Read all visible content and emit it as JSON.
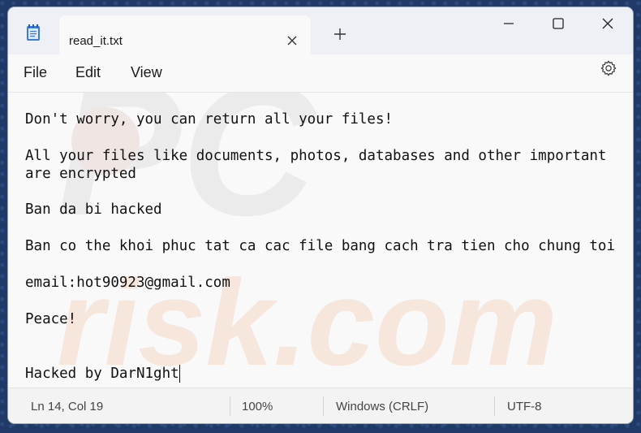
{
  "tab": {
    "title": "read_it.txt"
  },
  "menu": {
    "file": "File",
    "edit": "Edit",
    "view": "View"
  },
  "editor": {
    "lines": [
      "Don't worry, you can return all your files!",
      "All your files like documents, photos, databases and other important",
      "are encrypted",
      "Ban da bi hacked",
      "Ban co the khoi phuc tat ca cac file bang cach tra tien cho chung toi",
      "email:hot90923@gmail.com",
      "Peace!",
      "Hacked by DarN1ght"
    ]
  },
  "watermark": {
    "line1": "PC",
    "line2": "risk.com"
  },
  "status": {
    "position": "Ln 14, Col 19",
    "zoom": "100%",
    "line_ending": "Windows (CRLF)",
    "encoding": "UTF-8"
  },
  "icons": {
    "app": "notepad-icon",
    "tab_close": "close-icon",
    "new_tab": "plus-icon",
    "minimize": "minimize-icon",
    "maximize": "maximize-icon",
    "close": "close-icon",
    "settings": "gear-icon"
  }
}
